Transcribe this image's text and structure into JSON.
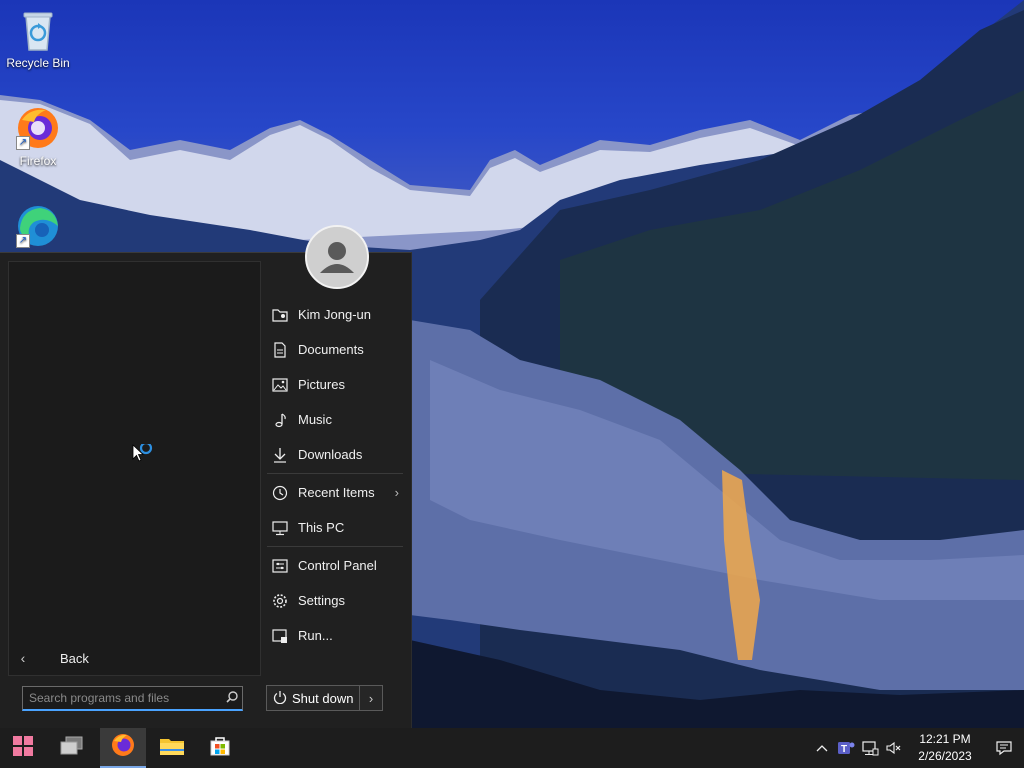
{
  "desktop": {
    "icons": [
      {
        "label": "Recycle Bin"
      },
      {
        "label": "Firefox"
      },
      {
        "label": ""
      }
    ]
  },
  "start_menu": {
    "search": {
      "placeholder": "Search programs and files"
    },
    "back_label": "Back",
    "places": [
      {
        "label": "Kim Jong-un",
        "icon": "user-folder-icon"
      },
      {
        "label": "Documents",
        "icon": "document-icon"
      },
      {
        "label": "Pictures",
        "icon": "picture-icon"
      },
      {
        "label": "Music",
        "icon": "music-note-icon"
      },
      {
        "label": "Downloads",
        "icon": "download-arrow-icon"
      },
      {
        "label": "Recent Items",
        "icon": "clock-icon"
      },
      {
        "label": "This PC",
        "icon": "computer-icon"
      },
      {
        "label": "Control Panel",
        "icon": "control-panel-icon"
      },
      {
        "label": "Settings",
        "icon": "gear-icon"
      },
      {
        "label": "Run...",
        "icon": "run-icon"
      }
    ],
    "shutdown_label": "Shut down"
  },
  "taskbar": {
    "apps": [
      "start-button",
      "task-view",
      "firefox",
      "file-explorer",
      "microsoft-store"
    ],
    "clock": {
      "time": "12:21 PM",
      "date": "2/26/2023"
    }
  },
  "colors": {
    "accent": "#4aa3ff",
    "menu_bg": "#202020",
    "taskbar_bg": "#1d1d1d"
  }
}
